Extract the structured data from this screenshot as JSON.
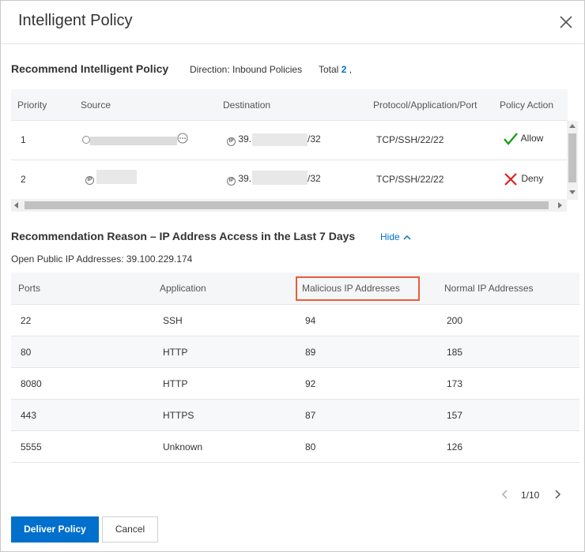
{
  "dialog": {
    "title": "Intelligent Policy"
  },
  "recommend": {
    "title": "Recommend Intelligent Policy",
    "direction_label": "Direction: Inbound Policies",
    "total_label": "Total",
    "total_value": "2",
    "total_suffix": ",",
    "columns": [
      "Priority",
      "Source",
      "Destination",
      "Protocol/Application/Port",
      "Policy Action"
    ],
    "rows": [
      {
        "priority": "1",
        "destination_prefix": "39.",
        "destination_suffix": "/32",
        "protocol": "TCP/SSH/22/22",
        "action": "Allow"
      },
      {
        "priority": "2",
        "destination_prefix": "39.",
        "destination_suffix": "/32",
        "protocol": "TCP/SSH/22/22",
        "action": "Deny"
      }
    ]
  },
  "reason": {
    "title": "Recommendation Reason – IP Address Access in the Last 7 Days",
    "hide_label": "Hide",
    "open_ip_label": "Open Public IP Addresses:",
    "open_ip_value": "39.100.229.174",
    "columns": [
      "Ports",
      "Application",
      "Malicious IP Addresses",
      "Normal IP Addresses"
    ],
    "rows": [
      {
        "port": "22",
        "application": "SSH",
        "malicious": "94",
        "normal": "200"
      },
      {
        "port": "80",
        "application": "HTTP",
        "malicious": "89",
        "normal": "185"
      },
      {
        "port": "8080",
        "application": "HTTP",
        "malicious": "92",
        "normal": "173"
      },
      {
        "port": "443",
        "application": "HTTPS",
        "malicious": "87",
        "normal": "157"
      },
      {
        "port": "5555",
        "application": "Unknown",
        "malicious": "80",
        "normal": "126"
      }
    ]
  },
  "pagination": {
    "page_label": "1/10"
  },
  "footer": {
    "deliver_label": "Deliver Policy",
    "cancel_label": "Cancel"
  },
  "colors": {
    "primary": "#0070cc",
    "allow": "#1e9e1e",
    "deny": "#e02020",
    "highlight": "#e85d3a"
  },
  "icons": {
    "close": "close-icon",
    "allow": "check-icon",
    "deny": "cross-icon",
    "hide": "chevron-up-icon",
    "prev": "chevron-left-icon",
    "next": "chevron-right-icon"
  }
}
